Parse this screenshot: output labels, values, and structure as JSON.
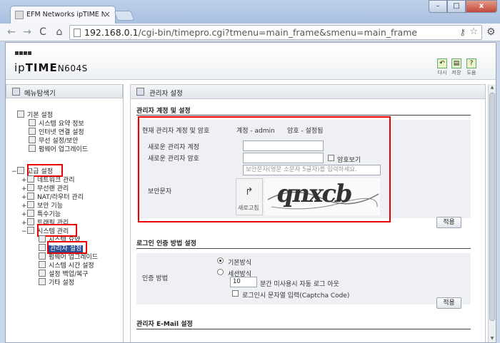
{
  "browser": {
    "tab_title": "EFM Networks ipTIME N(",
    "url_host": "192.168.0.1",
    "url_path": "/cgi-bin/timepro.cgi?tmenu=main_frame&smenu=main_frame"
  },
  "header": {
    "logo_prefix": "ip",
    "logo_brand": "TIME",
    "logo_model": "N604S",
    "icons": [
      {
        "label": "다시",
        "icon": "back-icon"
      },
      {
        "label": "저장",
        "icon": "save-icon"
      },
      {
        "label": "도움",
        "icon": "help-icon"
      }
    ]
  },
  "sidebar": {
    "title": "메뉴탐색기",
    "basic": {
      "label": "기본 설정",
      "items": [
        "시스템 요약 정보",
        "인터넷 연결 설정",
        "무선 설정/보안",
        "펌웨어 업그레이드"
      ]
    },
    "advanced": {
      "label": "고급 설정",
      "groups": [
        "네트워크 관리",
        "무선랜 관리",
        "NAT/라우터 관리",
        "보안 기능",
        "특수기능",
        "트래픽 관리"
      ],
      "system": {
        "label": "시스템 관리",
        "items": [
          "시스템 요약",
          "관리자 설정",
          "펌웨어 업그레이드",
          "시스템 시간 설정",
          "설정 백업/복구",
          "기타 설정"
        ]
      }
    }
  },
  "main": {
    "panel_title": "관리자 설정",
    "account_section": {
      "title": "관리자 계정 및 설정",
      "current_label": "현재 관리자 계정 및 암호",
      "current_value": "계정 - admin",
      "current_pw_value": "암호 - 설정됨",
      "new_account_label": "새로운 관리자 계정",
      "new_password_label": "새로운 관리자 암호",
      "show_password_label": "암호보기",
      "captcha_label": "보안문자",
      "captcha_placeholder": "보안문자(영문 소문자 5글자)를 입력하세요.",
      "refresh_label": "새로고침",
      "captcha_image_text": "qnxcb",
      "apply_label": "적용"
    },
    "login_section": {
      "title": "로그인 인증 방법 설정",
      "method_label": "인증 방법",
      "option_basic": "기본방식",
      "option_session": "세션방식",
      "timeout_value": "10",
      "timeout_suffix": "분간 미사용시 자동 로그 아웃",
      "captcha_login_label": "로그인시 문자열 입력(Captcha Code)",
      "apply_label": "적용"
    },
    "email_section": {
      "title": "관리자 E-Mail 설정"
    }
  }
}
